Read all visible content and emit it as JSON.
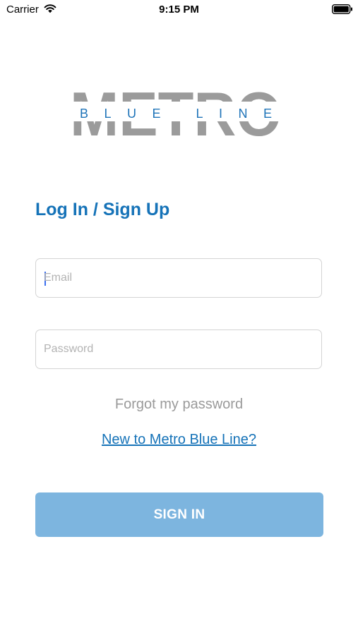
{
  "status_bar": {
    "carrier": "Carrier",
    "time": "9:15 PM",
    "wifi_icon": "wifi-icon",
    "battery_icon": "battery-icon"
  },
  "logo": {
    "word": "METRO",
    "subword": "BLUE LINE",
    "gray_color": "#9b9b9b",
    "blue_color": "#1e73b8"
  },
  "auth": {
    "heading": "Log In / Sign Up",
    "email_placeholder": "Email",
    "password_placeholder": "Password",
    "forgot_label": "Forgot my password",
    "new_link_label": "New to Metro Blue Line?",
    "signin_label": "SIGN IN"
  },
  "colors": {
    "accent": "#1673b8",
    "button": "#7db5df",
    "muted": "#9a9a9a"
  }
}
